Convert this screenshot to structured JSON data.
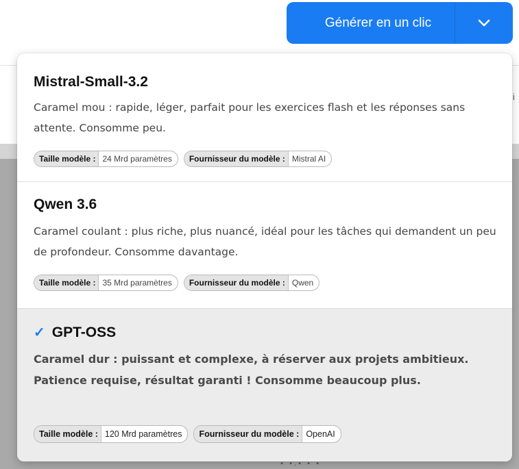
{
  "button": {
    "label": "Générer en un clic",
    "arrow_icon": "chevron-down-icon",
    "color": "#1a7cf2"
  },
  "options": [
    {
      "title": "Mistral-Small-3.2",
      "selected": false,
      "description": "Caramel mou : rapide, léger, parfait pour les exercices flash et les réponses sans attente. Consomme peu.",
      "tags": [
        {
          "key": "Taille modèle :",
          "value": "24 Mrd paramètres"
        },
        {
          "key": "Fournisseur du modèle :",
          "value": "Mistral AI"
        }
      ]
    },
    {
      "title": "Qwen 3.6",
      "selected": false,
      "description": "Caramel coulant : plus riche, plus nuancé, idéal pour les tâches qui demandent un peu de profondeur. Consomme davantage.",
      "tags": [
        {
          "key": "Taille modèle :",
          "value": "35 Mrd paramètres"
        },
        {
          "key": "Fournisseur du modèle :",
          "value": "Qwen"
        }
      ]
    },
    {
      "title": "GPT-OSS",
      "selected": true,
      "check_icon": "checkmark-icon",
      "description": "Caramel dur : puissant et complexe, à réserver aux projets ambitieux. Patience requise, résultat garanti ! Consomme beaucoup plus.",
      "tags": [
        {
          "key": "Taille modèle :",
          "value": "120 Mrd paramètres"
        },
        {
          "key": "Fournisseur du modèle :",
          "value": "OpenAI"
        }
      ]
    }
  ],
  "background": {
    "edge_text": "i",
    "dots": "• •.• • •"
  }
}
